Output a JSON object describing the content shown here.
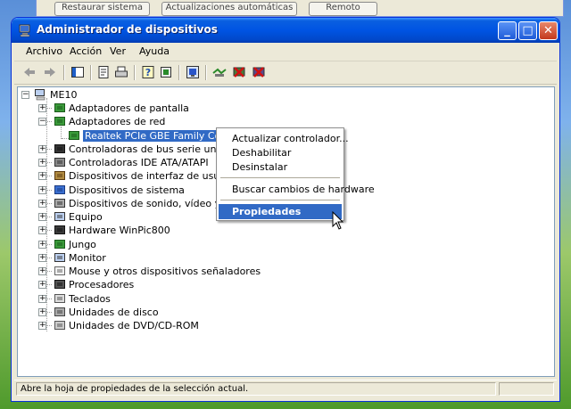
{
  "background_window": {
    "buttons": [
      "Restaurar sistema",
      "Actualizaciones automáticas",
      "Remoto"
    ]
  },
  "window": {
    "title": "Administrador de dispositivos",
    "controls": {
      "minimize": "_",
      "maximize": "□",
      "close": "✕"
    }
  },
  "menubar": {
    "items": [
      "Archivo",
      "Acción",
      "Ver",
      "Ayuda"
    ]
  },
  "toolbar": {
    "icons": [
      "back-arrow-icon",
      "forward-arrow-icon",
      "show-hide-console-tree-icon",
      "properties-icon",
      "print-icon",
      "help-icon",
      "scan-hardware-icon",
      "update-driver-icon",
      "uninstall-icon",
      "disable-icon"
    ]
  },
  "tree": {
    "root": "ME10",
    "items": [
      {
        "label": "Adaptadores de pantalla",
        "icon": "display-adapter-icon",
        "expander": "+"
      },
      {
        "label": "Adaptadores de red",
        "icon": "network-adapter-icon",
        "expander": "−"
      },
      {
        "label": "Realtek PCIe GBE Family Controller",
        "icon": "network-card-icon",
        "child": true,
        "selected": true
      },
      {
        "label": "Controladoras de bus serie universal (USB)",
        "icon": "usb-icon",
        "expander": "+"
      },
      {
        "label": "Controladoras IDE ATA/ATAPI",
        "icon": "ide-controller-icon",
        "expander": "+"
      },
      {
        "label": "Dispositivos de interfaz de usuario (HID)",
        "icon": "hid-device-icon",
        "expander": "+"
      },
      {
        "label": "Dispositivos de sistema",
        "icon": "system-device-icon",
        "expander": "+"
      },
      {
        "label": "Dispositivos de sonido, vídeo y juegos",
        "icon": "sound-device-icon",
        "expander": "+"
      },
      {
        "label": "Equipo",
        "icon": "computer-icon",
        "expander": "+"
      },
      {
        "label": "Hardware WinPic800",
        "icon": "hardware-winpic-icon",
        "expander": "+"
      },
      {
        "label": "Jungo",
        "icon": "jungo-icon",
        "expander": "+"
      },
      {
        "label": "Monitor",
        "icon": "monitor-icon",
        "expander": "+"
      },
      {
        "label": "Mouse y otros dispositivos señaladores",
        "icon": "mouse-icon",
        "expander": "+"
      },
      {
        "label": "Procesadores",
        "icon": "processor-icon",
        "expander": "+"
      },
      {
        "label": "Teclados",
        "icon": "keyboard-icon",
        "expander": "+"
      },
      {
        "label": "Unidades de disco",
        "icon": "disk-drive-icon",
        "expander": "+"
      },
      {
        "label": "Unidades de DVD/CD-ROM",
        "icon": "dvd-drive-icon",
        "expander": "+"
      }
    ]
  },
  "context_menu": {
    "items": [
      {
        "label": "Actualizar controlador...",
        "highlighted": false
      },
      {
        "label": "Deshabilitar",
        "highlighted": false
      },
      {
        "label": "Desinstalar",
        "highlighted": false
      },
      {
        "separator": true
      },
      {
        "label": "Buscar cambios de hardware",
        "highlighted": false
      },
      {
        "separator": true
      },
      {
        "label": "Propiedades",
        "highlighted": true
      }
    ]
  },
  "statusbar": {
    "text": "Abre la hoja de propiedades de la selección actual."
  },
  "colors": {
    "titlebar": "#0054e3",
    "selection": "#316ac5",
    "window_bg": "#ece9d8"
  }
}
